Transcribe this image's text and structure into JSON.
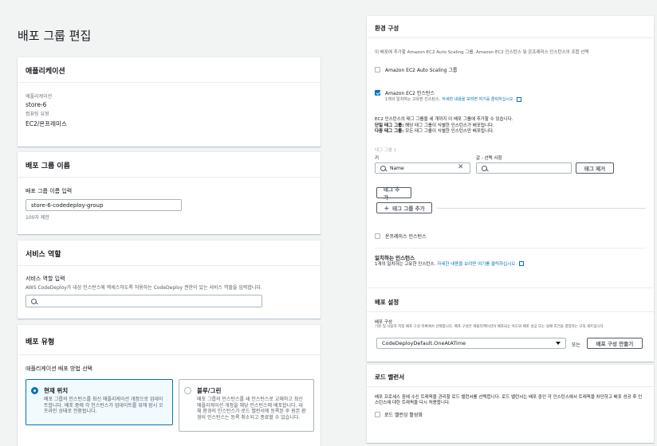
{
  "page_title": "배포 그룹 편집",
  "application": {
    "header": "애플리케이션",
    "app_label": "애플리케이션",
    "app_value": "store-6",
    "platform_label": "컴퓨팅 유형",
    "platform_value": "EC2/온프레미스"
  },
  "group_name": {
    "header": "배포 그룹 이름",
    "label": "배포 그룹 이름 입력",
    "value": "store-6-codedeploy-group",
    "hint": "100자 제한"
  },
  "service_role": {
    "header": "서비스 역할",
    "label": "서비스 역할 입력",
    "desc": "AWS CodeDeploy가 대상 인스턴스에 액세스하도록 허용하는 CodeDeploy 권한이 있는 서비스 역할을 입력합니다.",
    "value": ""
  },
  "deployment_type": {
    "header": "배포 유형",
    "label": "애플리케이션 배포 방법 선택",
    "options": [
      {
        "title": "현재 위치",
        "desc": "배포 그룹의 인스턴스를 최신 애플리케이션 개정으로 업데이트합니다. 배포 중에 각 인스턴스가 업데이트를 위해 잠시 오프라인 상태로 전환됩니다.",
        "selected": true
      },
      {
        "title": "블루/그린",
        "desc": "배포 그룹의 인스턴스를 새 인스턴스로 교체하고 최신 애플리케이션 개정을 해당 인스턴스에 배포합니다. 대체 환경의 인스턴스가 로드 밸런서에 등록된 후 원본 환경의 인스턴스는 등록 취소되고 종료할 수 있습니다.",
        "selected": false
      }
    ]
  },
  "environment": {
    "header": "환경 구성",
    "desc": "이 배포에 추가할 Amazon EC2 Auto Scaling 그룹, Amazon EC2 인스턴스 및 온프레미스 인스턴스의 조합 선택",
    "asg_label": "Amazon EC2 Auto Scaling 그룹",
    "ec2_label": "Amazon EC2 인스턴스",
    "ec2_desc": "1개의 일치하는 고유한 인스턴스.",
    "ec2_link": "자세한 내용을 보려면 여기를 클릭하십시오.",
    "tag_intro": "EC2 인스턴스의 태그 그룹을 세 개까지 이 배포 그룹에 추가할 수 있습니다.",
    "tag_single_b": "단일 태그 그룹:",
    "tag_single": " 해당 태그 그룹이 식별한 인스턴스가 배포됩니다.",
    "tag_multi_b": "다중 태그 그룹:",
    "tag_multi": " 모든 태그 그룹이 식별한 인스턴스만 배포됩니다.",
    "tag_group_label": "태그 그룹 1",
    "key_label": "키",
    "value_label": "값 - 선택 사항",
    "key_value": "Name",
    "value_value": "",
    "remove_tag": "태그 제거",
    "add_tag": "태그 추가",
    "add_tag_group": "태그 그룹 추가",
    "onprem_label": "온프레미스 인스턴스",
    "match_title": "일치하는 인스턴스",
    "match_desc": "1개의 일치하는 고유한 인스턴스.",
    "match_link": "자세한 내용을 보려면 여기를 클릭하십시오."
  },
  "deploy_settings": {
    "header": "배포 설정",
    "label": "배포 구성",
    "desc": "기본 및 사용자 지정 배포 구성 목록에서 선택합니다. 배포 구성은 애플리케이션이 배포되는 속도와 배포 성공 또는 실패 조건을 결정하는 규칙 세트입니다.",
    "value": "CodeDeployDefault.OneAtATime",
    "or": "또는",
    "create_btn": "배포 구성 만들기"
  },
  "load_balancer": {
    "header": "로드 밸런서",
    "desc": "배포 프로세스 중에 수신 트래픽을 관리할 로드 밸런서를 선택합니다. 로드 밸런서는 배포 중인 각 인스턴스에서 트래픽을 차단하고 배포 성공 후 인스턴스에 대한 트래픽을 다시 허용합니다.",
    "enable_label": "로드 밸런싱 활성화"
  }
}
